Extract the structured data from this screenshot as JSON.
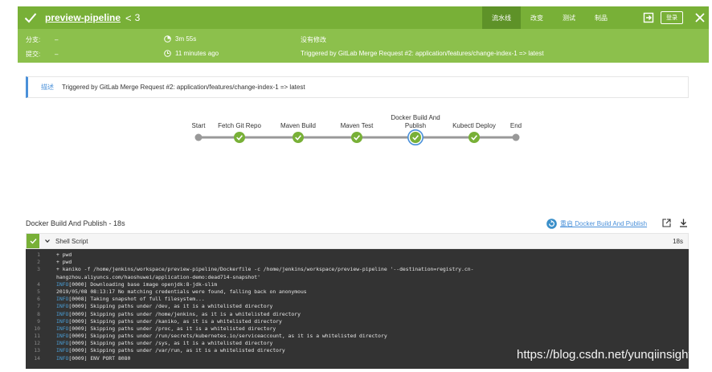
{
  "header": {
    "title": "preview-pipeline",
    "separator": "<",
    "run_number": "3",
    "tabs": [
      "流水线",
      "改变",
      "测试",
      "制品"
    ],
    "active_tab": 0,
    "login_label": "登录"
  },
  "info": {
    "branch_label": "分支:",
    "branch_value": "–",
    "commit_label": "提交:",
    "commit_value": "–",
    "duration": "3m 55s",
    "started": "11 minutes ago",
    "changes": "没有修改",
    "trigger": "Triggered by GitLab Merge Request #2: application/features/change-index-1 => latest"
  },
  "description": {
    "label": "描述",
    "text": "Triggered by GitLab Merge Request #2: application/features/change-index-1 => latest"
  },
  "pipeline": {
    "stages": [
      {
        "label": "Start",
        "status": "start"
      },
      {
        "label": "Fetch Git Repo",
        "status": "success"
      },
      {
        "label": "Maven Build",
        "status": "success"
      },
      {
        "label": "Maven Test",
        "status": "success"
      },
      {
        "label": "Docker Build And Publish",
        "status": "selected"
      },
      {
        "label": "Kubectl Deploy",
        "status": "success"
      },
      {
        "label": "End",
        "status": "end"
      }
    ]
  },
  "log": {
    "title": "Docker Build And Publish - 18s",
    "restart_label": "重启 Docker Build And Publish",
    "step_name": "Shell Script",
    "step_time": "18s",
    "lines": [
      {
        "n": "1",
        "prefix": "",
        "text": "+ pwd"
      },
      {
        "n": "2",
        "prefix": "",
        "text": "+ pwd"
      },
      {
        "n": "3",
        "prefix": "",
        "text": "+ kaniko -f /home/jenkins/workspace/preview-pipeline/Dockerfile -c /home/jenkins/workspace/preview-pipeline '--destination=registry.cn-"
      },
      {
        "n": "",
        "prefix": "",
        "text": "hangzhou.aliyuncs.com/haoshuwei/application-demo:dead714-snapshot'"
      },
      {
        "n": "4",
        "prefix": "INFO",
        "text": "[0000] Downloading base image openjdk:8-jdk-slim"
      },
      {
        "n": "5",
        "prefix": "",
        "text": "2019/05/08 08:13:17 No matching credentials were found, falling back on anonymous"
      },
      {
        "n": "6",
        "prefix": "INFO",
        "text": "[0008] Taking snapshot of full filesystem..."
      },
      {
        "n": "7",
        "prefix": "INFO",
        "text": "[0009] Skipping paths under /dev, as it is a whitelisted directory"
      },
      {
        "n": "8",
        "prefix": "INFO",
        "text": "[0009] Skipping paths under /home/jenkins, as it is a whitelisted directory"
      },
      {
        "n": "9",
        "prefix": "INFO",
        "text": "[0009] Skipping paths under /kaniko, as it is a whitelisted directory"
      },
      {
        "n": "10",
        "prefix": "INFO",
        "text": "[0009] Skipping paths under /proc, as it is a whitelisted directory"
      },
      {
        "n": "11",
        "prefix": "INFO",
        "text": "[0009] Skipping paths under /run/secrets/kubernetes.io/serviceaccount, as it is a whitelisted directory"
      },
      {
        "n": "12",
        "prefix": "INFO",
        "text": "[0009] Skipping paths under /sys, as it is a whitelisted directory"
      },
      {
        "n": "13",
        "prefix": "INFO",
        "text": "[0009] Skipping paths under /var/run, as it is a whitelisted directory"
      },
      {
        "n": "14",
        "prefix": "INFO",
        "text": "[0009] ENV PORT 8080"
      }
    ]
  },
  "watermark": "https://blog.csdn.net/yunqiinsight",
  "colors": {
    "success": "#78b037",
    "accent": "#4a90d9",
    "console_bg": "#333333"
  }
}
